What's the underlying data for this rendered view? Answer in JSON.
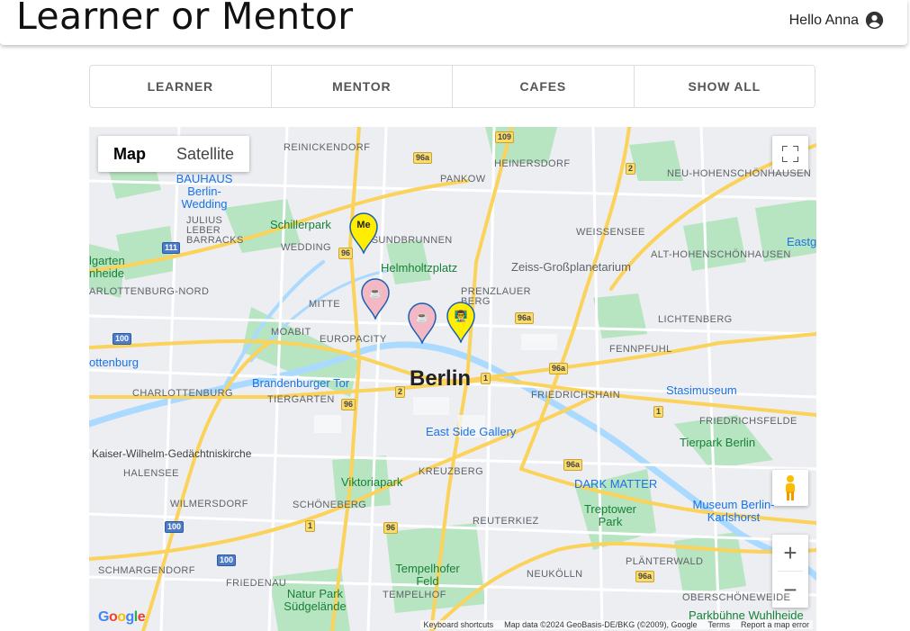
{
  "header": {
    "title": "Learner or Mentor",
    "greeting": "Hello Anna",
    "user_icon": "account-circle-icon"
  },
  "tabs": [
    "LEARNER",
    "MENTOR",
    "CAFES",
    "SHOW ALL"
  ],
  "map": {
    "type_control": {
      "map_label": "Map",
      "satellite_label": "Satellite",
      "selected": "Map"
    },
    "city_label": "Berlin",
    "district_labels": [
      "REINICKENDORF",
      "HEINERSDORF",
      "PANKOW",
      "NEU-HOHENSCHÖNHAUSEN",
      "JULIUS LEBER BARRACKS",
      "WEDDING",
      "GESUNDBRUNNEN",
      "WEISSENSEE",
      "ALT-HOHENSCHÖNHAUSEN",
      "ARLOTTENBURG-NORD",
      "MITTE",
      "PRENZLAUER BERG",
      "LICHTENBERG",
      "MOABIT",
      "EUROPACITY",
      "FENNPFUHL",
      "CHARLOTTENBURG",
      "TIERGARTEN",
      "FRIEDRICHSHAIN",
      "FRIEDRICHSFELDE",
      "HALENSEE",
      "KREUZBERG",
      "WILMERSDORF",
      "SCHÖNEBERG",
      "REUTERKIEZ",
      "PLÄNTERWALD",
      "SCHMARGENDORF",
      "FRIEDENAU",
      "TEMPELHOF",
      "NEUKÖLLN",
      "OBERSCHÖNEWEIDE"
    ],
    "poi_labels": [
      "BAUHAUS Berlin-Wedding",
      "Zeiss-Großplanetarium",
      "Brandenburger Tor",
      "Kaiser-Wilhelm-Gedächtniskirche",
      "East Side Gallery",
      "Stasimuseum",
      "DARK MATTER",
      "Museum Berlin-Karlshorst",
      "ottenburg",
      "Eastg"
    ],
    "park_labels": [
      "Schillerpark",
      "Helmholtzplatz",
      "Viktoriapark",
      "Treptower Park",
      "Tempelhofer Feld",
      "Tierpark Berlin",
      "Natur Park Südgelände",
      "lgarten nheide",
      "Parkbühne Wuhlheide"
    ],
    "road_shields": [
      "109",
      "96a",
      "2",
      "111",
      "96",
      "96a",
      "100",
      "96a",
      "1",
      "2",
      "96",
      "1",
      "96a",
      "100",
      "1",
      "96",
      "100",
      "96a"
    ],
    "markers": [
      {
        "label": "Me",
        "color": "#ffee00",
        "kind": "me"
      },
      {
        "label": "☕",
        "color": "#f4b8c4",
        "kind": "cafe"
      },
      {
        "label": "☕",
        "color": "#f4b8c4",
        "kind": "cafe"
      },
      {
        "label": "👨‍🏫",
        "color": "#ffee00",
        "kind": "mentor"
      }
    ],
    "controls": {
      "fullscreen_icon": "fullscreen-icon",
      "pegman_icon": "pegman-icon",
      "zoom_in": "+",
      "zoom_out": "−"
    },
    "footer": {
      "google_logo": "Google",
      "shortcuts": "Keyboard shortcuts",
      "attribution": "Map data ©2024 GeoBasis-DE/BKG (©2009), Google",
      "terms": "Terms",
      "report": "Report a map error"
    },
    "colors": {
      "water": "#aadaff",
      "park": "#b7e4c1",
      "road_major": "#fbd25a",
      "road_minor": "#ffffff",
      "land": "#eceef1"
    }
  }
}
